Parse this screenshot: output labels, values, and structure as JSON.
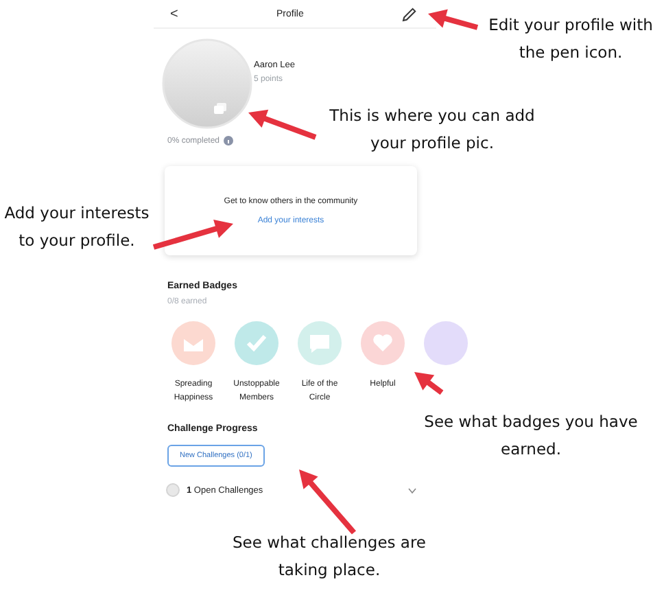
{
  "header": {
    "back": "<",
    "title": "Profile"
  },
  "profile": {
    "name": "Aaron Lee",
    "points": "5 points",
    "completion": "0% completed"
  },
  "interests_card": {
    "text": "Get to know others in the community",
    "link": "Add your interests"
  },
  "badges": {
    "title": "Earned Badges",
    "count": "0/8 earned",
    "items": [
      {
        "label": "Spreading Happiness",
        "color": "#fcd9d0"
      },
      {
        "label": "Unstoppable Members",
        "color": "#bfe9e9"
      },
      {
        "label": "Life of the Circle",
        "color": "#d3f0ec"
      },
      {
        "label": "Helpful",
        "color": "#fbd6d6"
      },
      {
        "color": "#e3dcfa"
      }
    ]
  },
  "challenges": {
    "title": "Challenge Progress",
    "button": "New Challenges (0/1)",
    "open_count": "1",
    "open_label": "Open Challenges",
    "expanded": false
  },
  "annotations": [
    {
      "text": "Edit your profile with the pen icon."
    },
    {
      "text": "This is where you can add your profile pic."
    },
    {
      "text": "Add your interests to your profile."
    },
    {
      "text": "See what badges you have earned."
    },
    {
      "text": "See what challenges are taking place."
    }
  ]
}
